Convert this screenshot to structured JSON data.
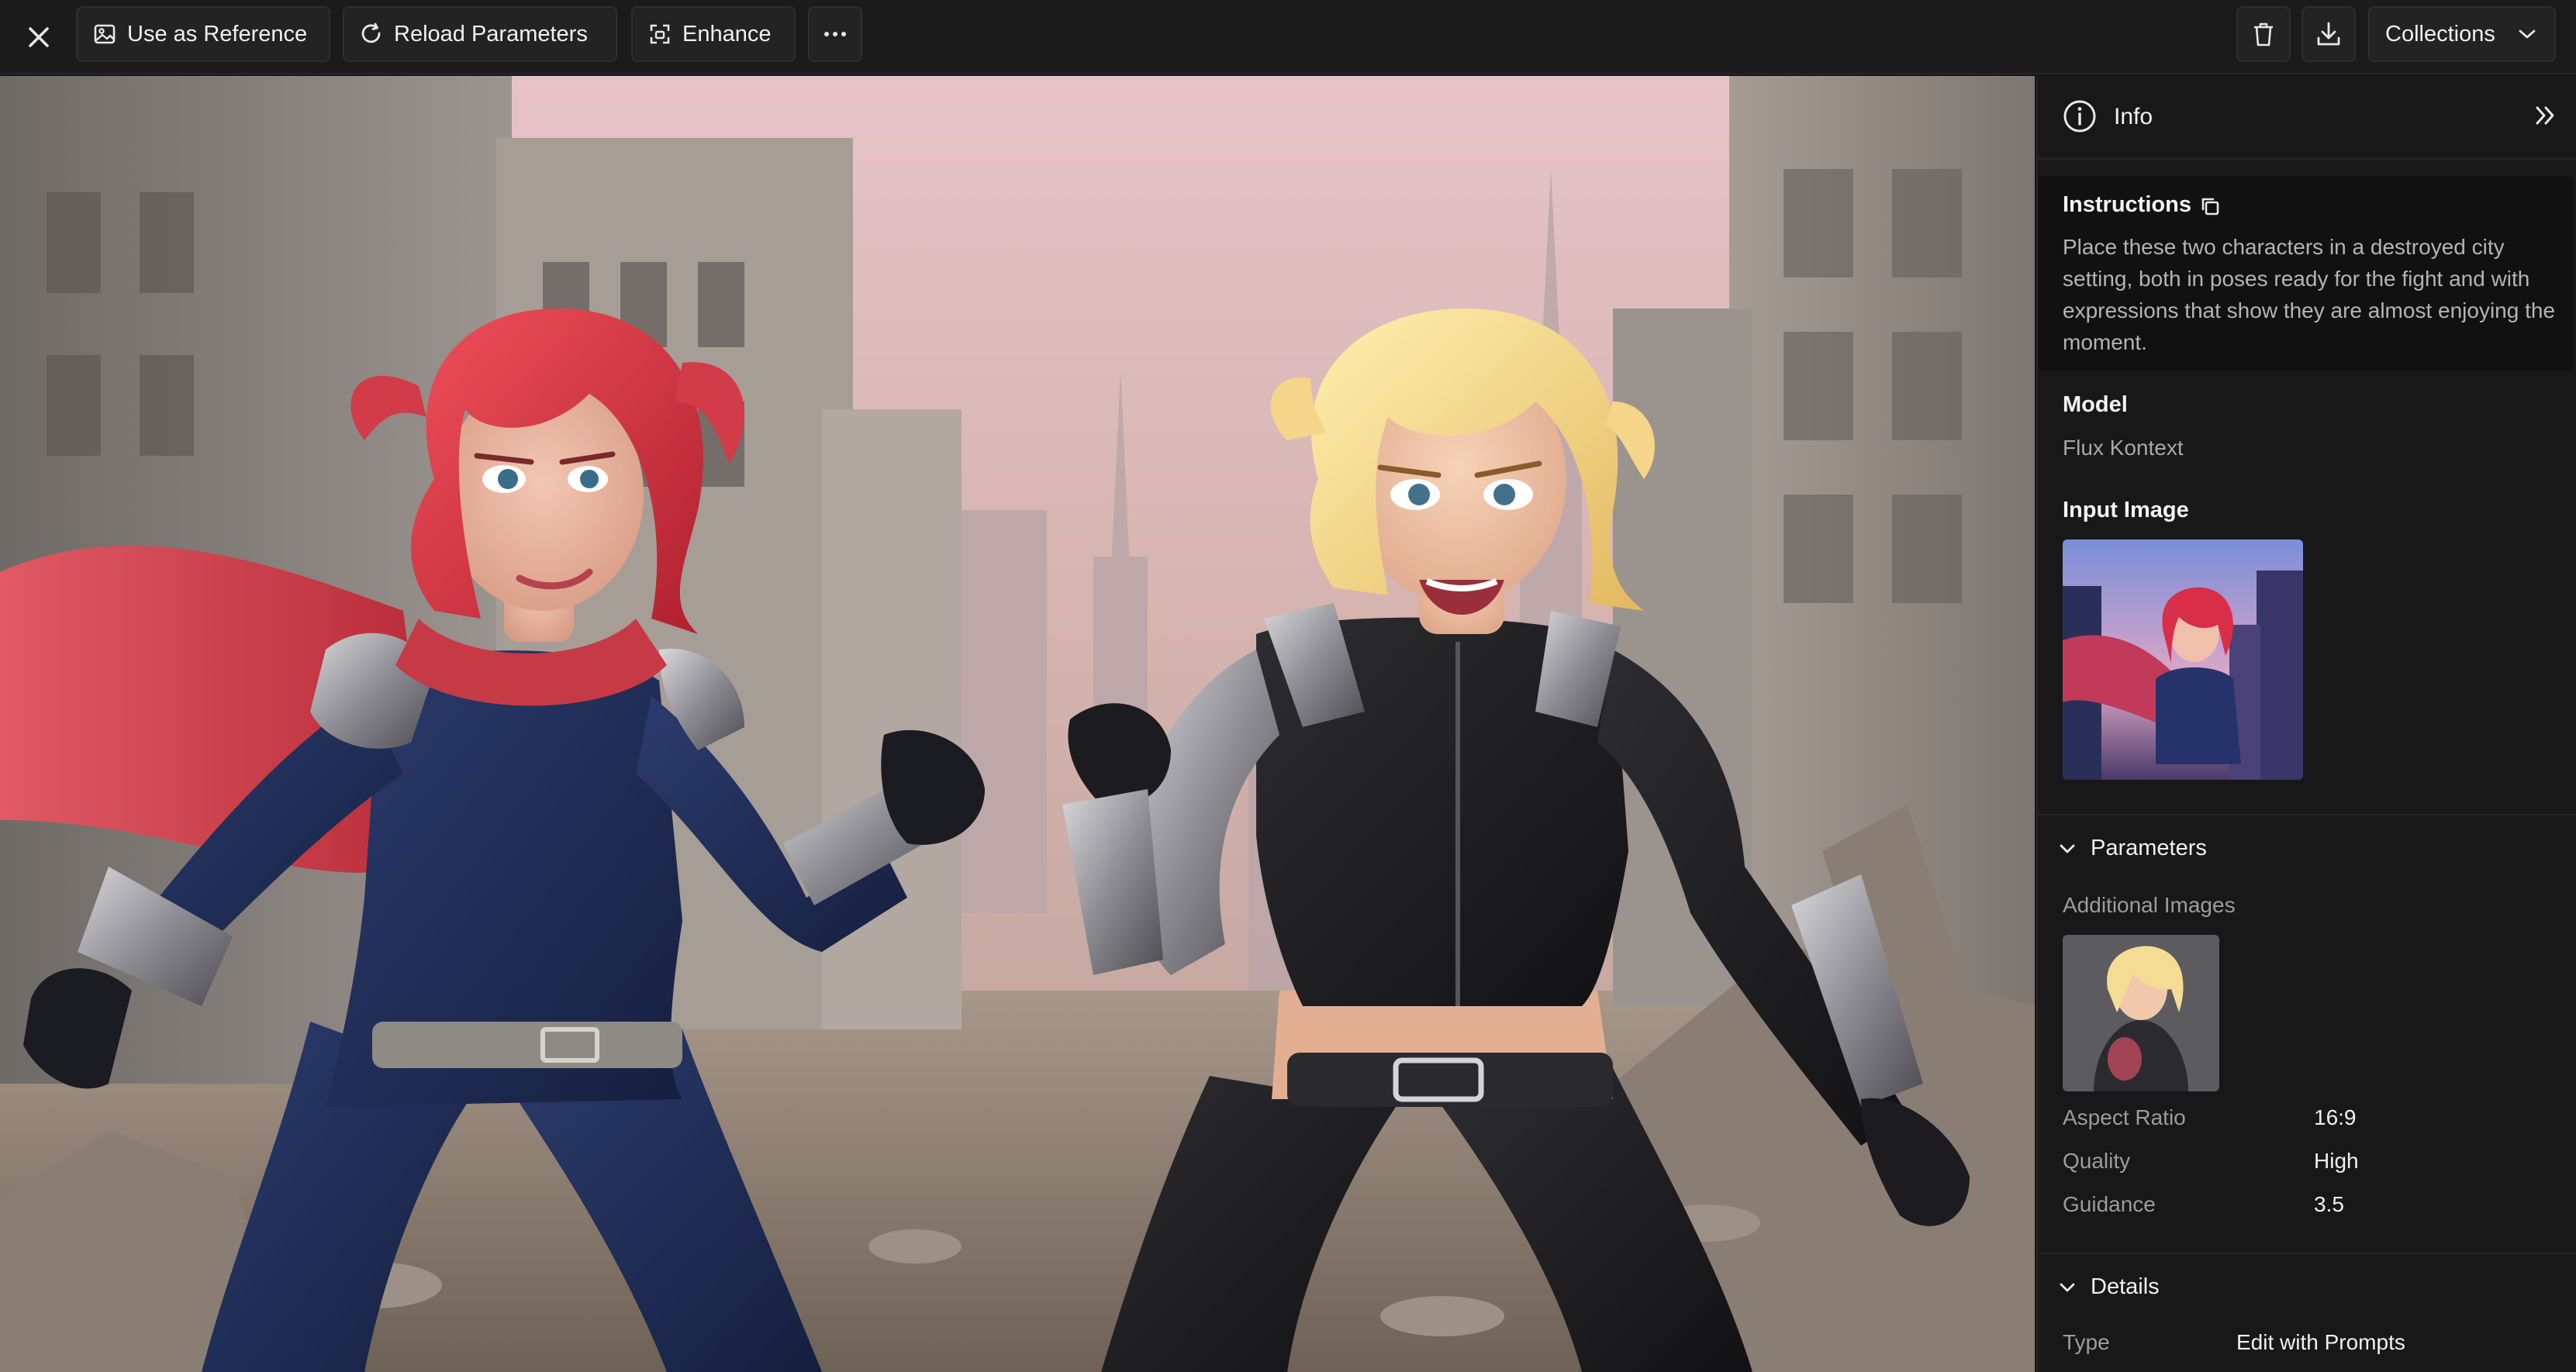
{
  "toolbar": {
    "use_as_reference": "Use as Reference",
    "reload_parameters": "Reload Parameters",
    "enhance": "Enhance",
    "collections": "Collections"
  },
  "panel": {
    "title": "Info",
    "instructions_label": "Instructions",
    "instructions_text": "Place these two characters in a destroyed city setting, both in poses ready for the fight and with expressions that show they are almost enjoying the moment.",
    "model_label": "Model",
    "model_value": "Flux Kontext",
    "input_image_label": "Input Image",
    "parameters_label": "Parameters",
    "additional_images_label": "Additional Images",
    "params": [
      {
        "key": "Aspect Ratio",
        "value": "16:9"
      },
      {
        "key": "Quality",
        "value": "High"
      },
      {
        "key": "Guidance",
        "value": "3.5"
      }
    ],
    "details_label": "Details",
    "details": [
      {
        "key": "Type",
        "value": "Edit with Prompts"
      }
    ]
  },
  "icons": {
    "close": "close-icon",
    "image": "image-icon",
    "reload": "reload-icon",
    "enhance": "enhance-icon",
    "more": "more-icon",
    "trash": "trash-icon",
    "download": "download-icon",
    "chevron": "chevron-down-icon",
    "info": "info-icon",
    "collapse": "double-chevron-right-icon",
    "copy": "copy-icon"
  },
  "colors": {
    "background": "#161616",
    "panel": "#181818",
    "redhead_suit": "#22305a",
    "blonde_suit": "#1e1e20"
  }
}
